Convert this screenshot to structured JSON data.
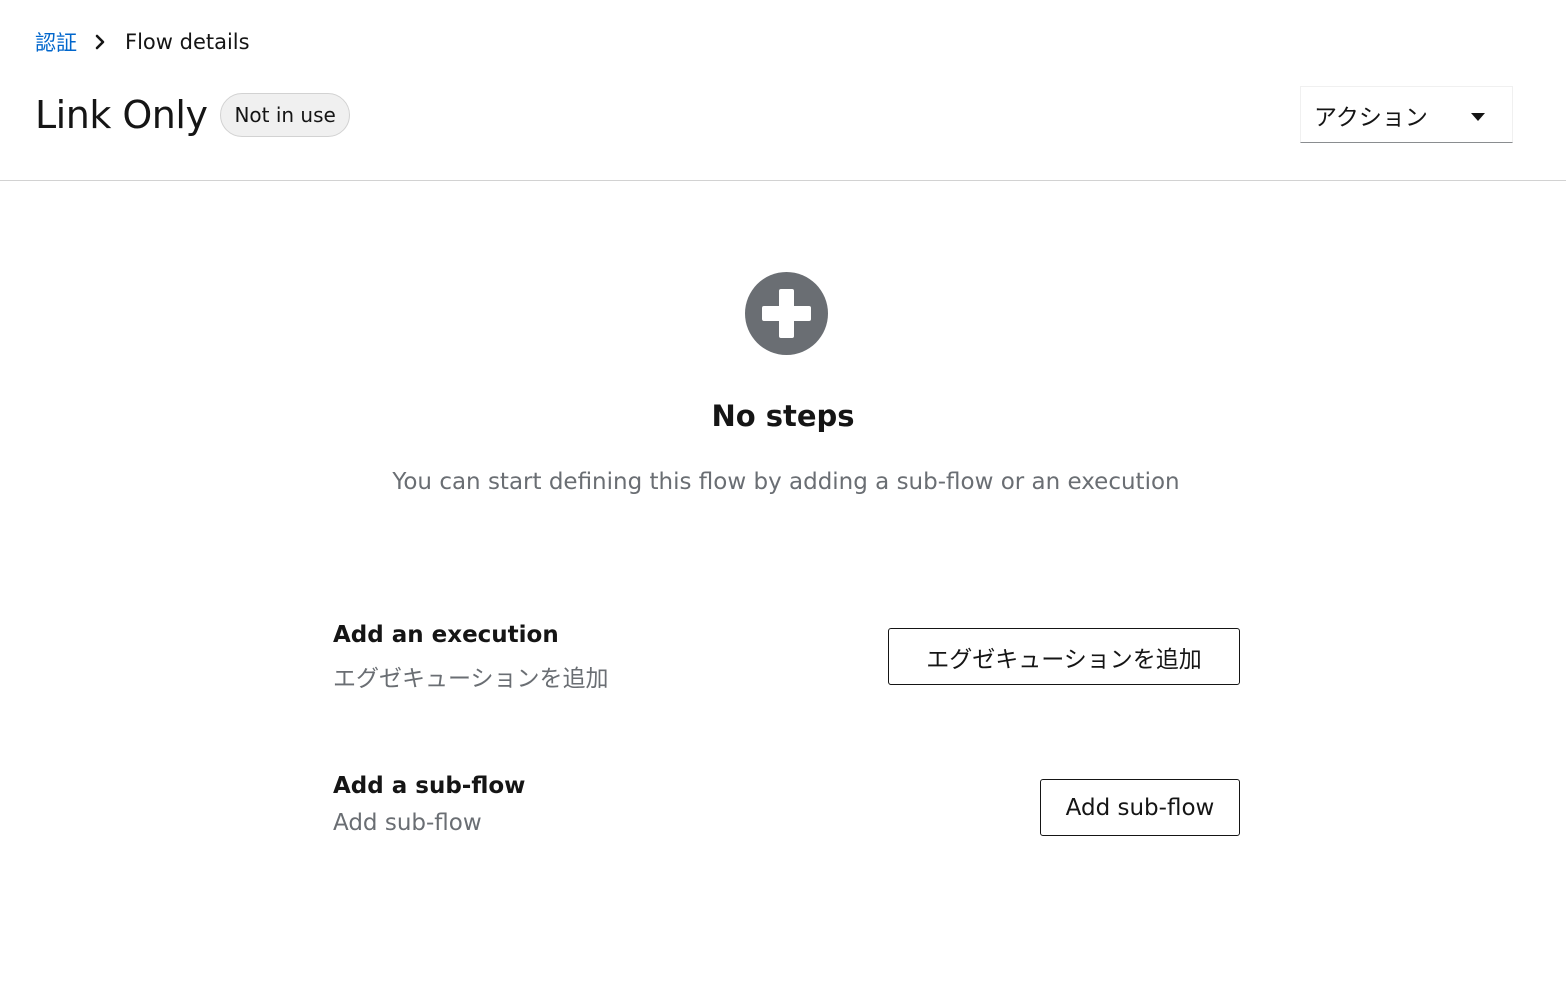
{
  "breadcrumb": {
    "parent": "認証",
    "current": "Flow details"
  },
  "header": {
    "title": "Link Only",
    "status_badge": "Not in use",
    "actions_label": "アクション"
  },
  "empty_state": {
    "icon": "plus-circle-icon",
    "title": "No steps",
    "body": "You can start defining this flow by adding a sub-flow or an execution"
  },
  "actions": {
    "execution": {
      "title": "Add an execution",
      "subtitle": "エグゼキューションを追加",
      "button_label": "エグゼキューションを追加"
    },
    "subflow": {
      "title": "Add a sub-flow",
      "subtitle": "Add sub-flow",
      "button_label": "Add sub-flow"
    }
  },
  "colors": {
    "link": "#0066cc",
    "text": "#151515",
    "muted": "#6a6e73",
    "icon": "#6a6e73",
    "border": "#d2d2d2"
  }
}
